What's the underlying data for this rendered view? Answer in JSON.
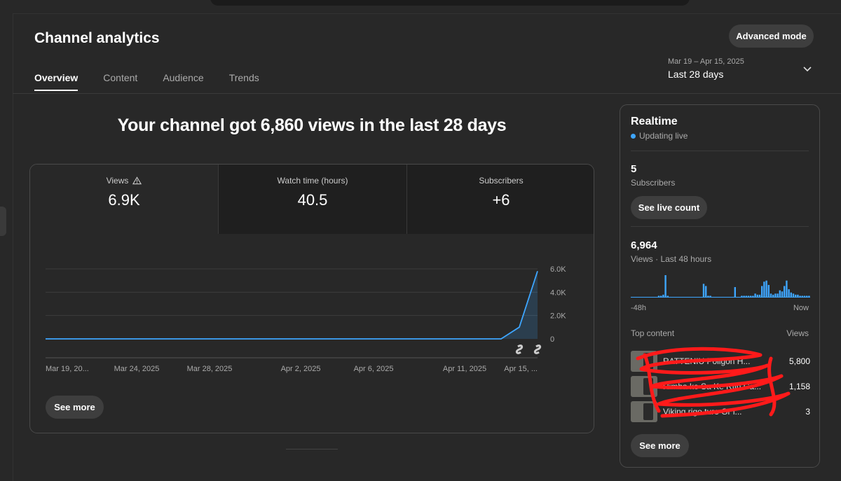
{
  "header": {
    "title": "Channel analytics",
    "advanced_mode_label": "Advanced mode",
    "tabs": [
      "Overview",
      "Content",
      "Audience",
      "Trends"
    ],
    "date_range": "Mar 19 – Apr 15, 2025",
    "date_label": "Last 28 days"
  },
  "overview": {
    "headline": "Your channel got 6,860 views in the last 28 days",
    "metrics": [
      {
        "label": "Views",
        "value": "6.9K"
      },
      {
        "label": "Watch time (hours)",
        "value": "40.5"
      },
      {
        "label": "Subscribers",
        "value": "+6"
      }
    ],
    "see_more_label": "See more"
  },
  "chart_data": {
    "type": "line",
    "series": [
      {
        "values": [
          0,
          0,
          0,
          0,
          0,
          0,
          0,
          0,
          0,
          0,
          0,
          0,
          0,
          0,
          0,
          0,
          0,
          0,
          0,
          0,
          0,
          0,
          0,
          0,
          0,
          0,
          1000,
          5800
        ]
      }
    ],
    "x": [
      "Mar 19",
      "Mar 20",
      "Mar 21",
      "Mar 22",
      "Mar 23",
      "Mar 24",
      "Mar 25",
      "Mar 26",
      "Mar 27",
      "Mar 28",
      "Mar 29",
      "Mar 30",
      "Mar 31",
      "Apr 1",
      "Apr 2",
      "Apr 3",
      "Apr 4",
      "Apr 5",
      "Apr 6",
      "Apr 7",
      "Apr 8",
      "Apr 9",
      "Apr 10",
      "Apr 11",
      "Apr 12",
      "Apr 13",
      "Apr 14",
      "Apr 15"
    ],
    "x_tick_labels": [
      {
        "index": 0,
        "label": "Mar 19, 20..."
      },
      {
        "index": 5,
        "label": "Mar 24, 2025"
      },
      {
        "index": 9,
        "label": "Mar 28, 2025"
      },
      {
        "index": 14,
        "label": "Apr 2, 2025"
      },
      {
        "index": 18,
        "label": "Apr 6, 2025"
      },
      {
        "index": 23,
        "label": "Apr 11, 2025"
      },
      {
        "index": 27,
        "label": "Apr 15, ..."
      }
    ],
    "y_ticks": [
      {
        "value": 0,
        "label": "0"
      },
      {
        "value": 2000,
        "label": "2.0K"
      },
      {
        "value": 4000,
        "label": "4.0K"
      },
      {
        "value": 6000,
        "label": "6.0K"
      }
    ],
    "ylim": [
      0,
      6000
    ],
    "grid": true,
    "markers": [
      {
        "index": 26,
        "icon": "shorts-icon"
      },
      {
        "index": 27,
        "icon": "shorts-icon"
      }
    ],
    "colors": {
      "line": "#3ea6ff",
      "fill": "#3ea6ff"
    }
  },
  "realtime": {
    "title": "Realtime",
    "status": "Updating live",
    "subscribers_value": "5",
    "subscribers_label": "Subscribers",
    "see_live_label": "See live count",
    "views_value": "6,964",
    "views_label": "Views · Last 48 hours",
    "bars": [
      0,
      0,
      0,
      0,
      0,
      0,
      0,
      0,
      0,
      0,
      0,
      0,
      0.05,
      0.05,
      0.1,
      1,
      0.05,
      0,
      0,
      0,
      0,
      0,
      0,
      0,
      0,
      0,
      0,
      0,
      0,
      0,
      0,
      0,
      0.6,
      0.5,
      0.05,
      0.05,
      0,
      0,
      0,
      0,
      0,
      0,
      0,
      0,
      0,
      0,
      0.45,
      0,
      0,
      0.05,
      0.05,
      0.05,
      0.05,
      0.05,
      0.05,
      0.15,
      0.1,
      0.1,
      0.5,
      0.7,
      0.75,
      0.55,
      0.15,
      0.1,
      0.15,
      0.15,
      0.3,
      0.25,
      0.5,
      0.75,
      0.35,
      0.2,
      0.15,
      0.1,
      0.1,
      0.05,
      0.05,
      0.05,
      0.05,
      0.05
    ],
    "axis_start": "-48h",
    "axis_end": "Now",
    "top_content_label": "Top content",
    "views_col_label": "Views",
    "items": [
      {
        "title": "RATTENIU Poligon H...",
        "views": "5,800"
      },
      {
        "title": "Rimba ke Sa Ke Rtin Ca...",
        "views": "1,158"
      },
      {
        "title": "Viking rigo ture Gr i...",
        "views": "3"
      }
    ],
    "see_more_label": "See more"
  }
}
